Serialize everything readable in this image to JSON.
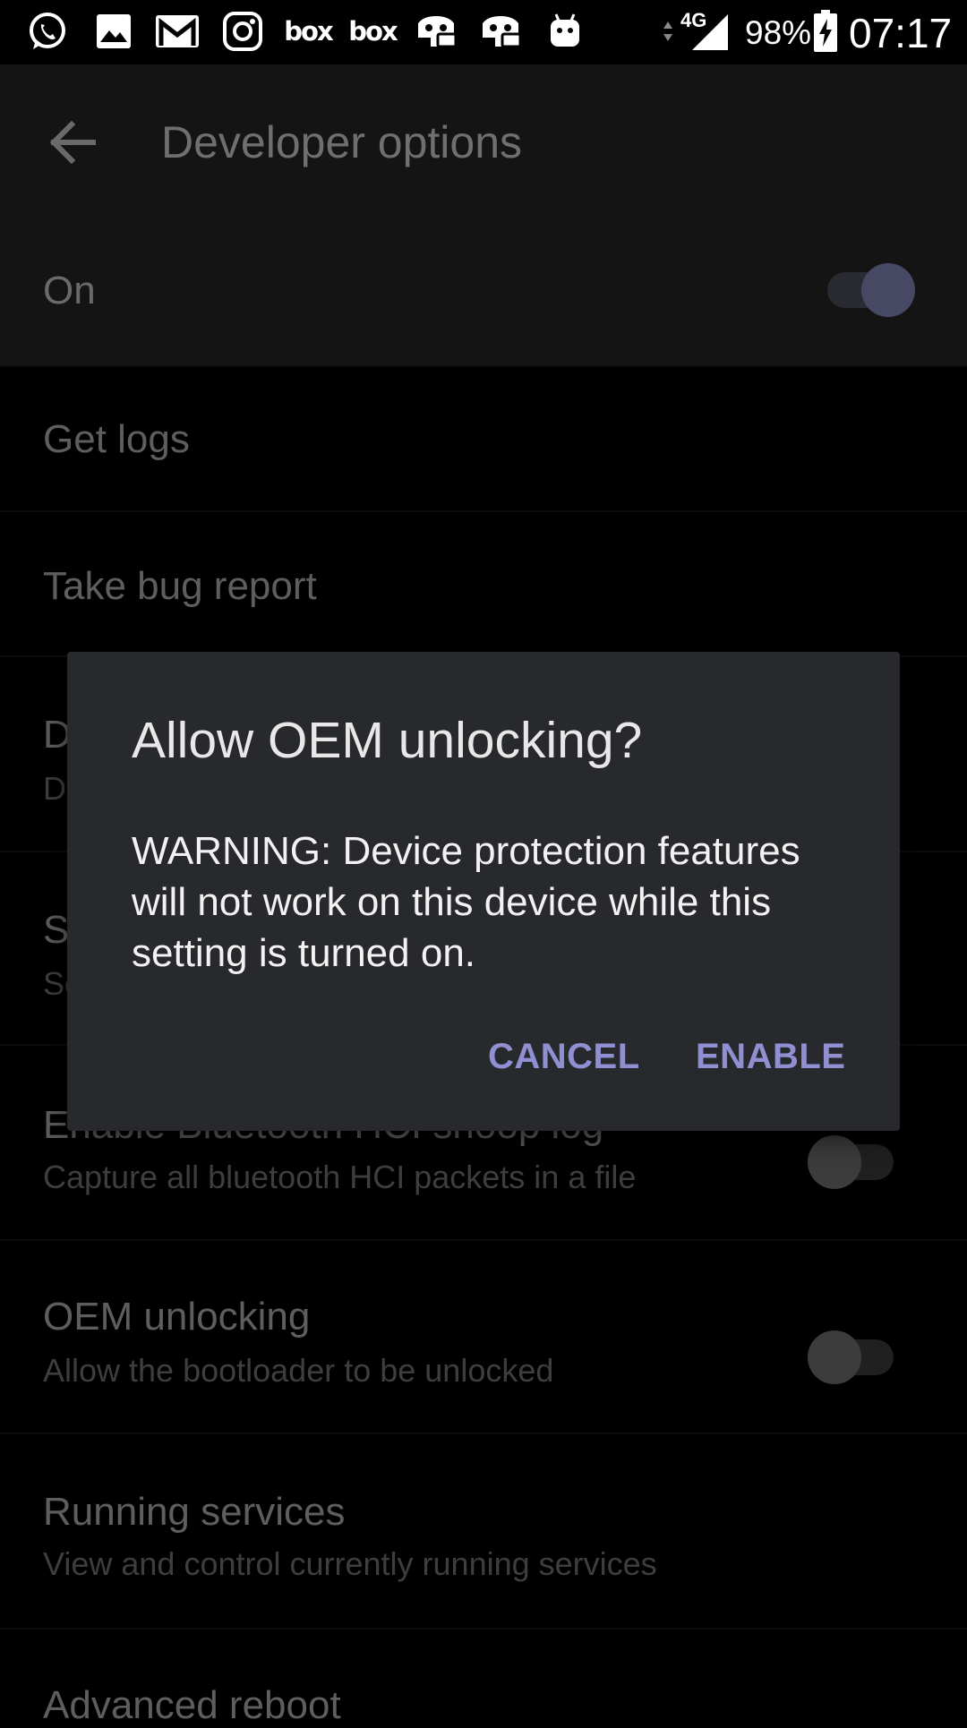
{
  "status_bar": {
    "notification_icons": [
      "whatsapp-icon",
      "gallery-icon",
      "gmail-icon",
      "instagram-icon",
      "box-icon",
      "box-icon",
      "discord-icon",
      "discord-icon",
      "android-icon"
    ],
    "box_text_1": "box",
    "box_text_2": "box",
    "network": "4G",
    "battery": "98%",
    "time": "07:17"
  },
  "app_bar": {
    "title": "Developer options"
  },
  "master": {
    "label": "On",
    "enabled": true
  },
  "settings": {
    "get_logs": {
      "title": "Get logs"
    },
    "bug_report": {
      "title": "Take bug report"
    },
    "hidden_1": {
      "title": "D",
      "subtitle": "D"
    },
    "hidden_2": {
      "title": "S",
      "subtitle": "Se"
    },
    "bluetooth": {
      "title": "Enable Bluetooth HCI snoop log",
      "subtitle": "Capture all bluetooth HCI packets in a file",
      "enabled": false
    },
    "oem": {
      "title": "OEM unlocking",
      "subtitle": "Allow the bootloader to be unlocked",
      "enabled": false
    },
    "running": {
      "title": "Running services",
      "subtitle": "View and control currently running services"
    },
    "reboot": {
      "title": "Advanced reboot"
    }
  },
  "dialog": {
    "title": "Allow OEM unlocking?",
    "message": "WARNING: Device protection features will not work on this device while this setting is turned on.",
    "cancel_label": "CANCEL",
    "enable_label": "ENABLE"
  },
  "colors": {
    "accent": "#8f8fd2",
    "dialog_bg": "#28292c"
  }
}
